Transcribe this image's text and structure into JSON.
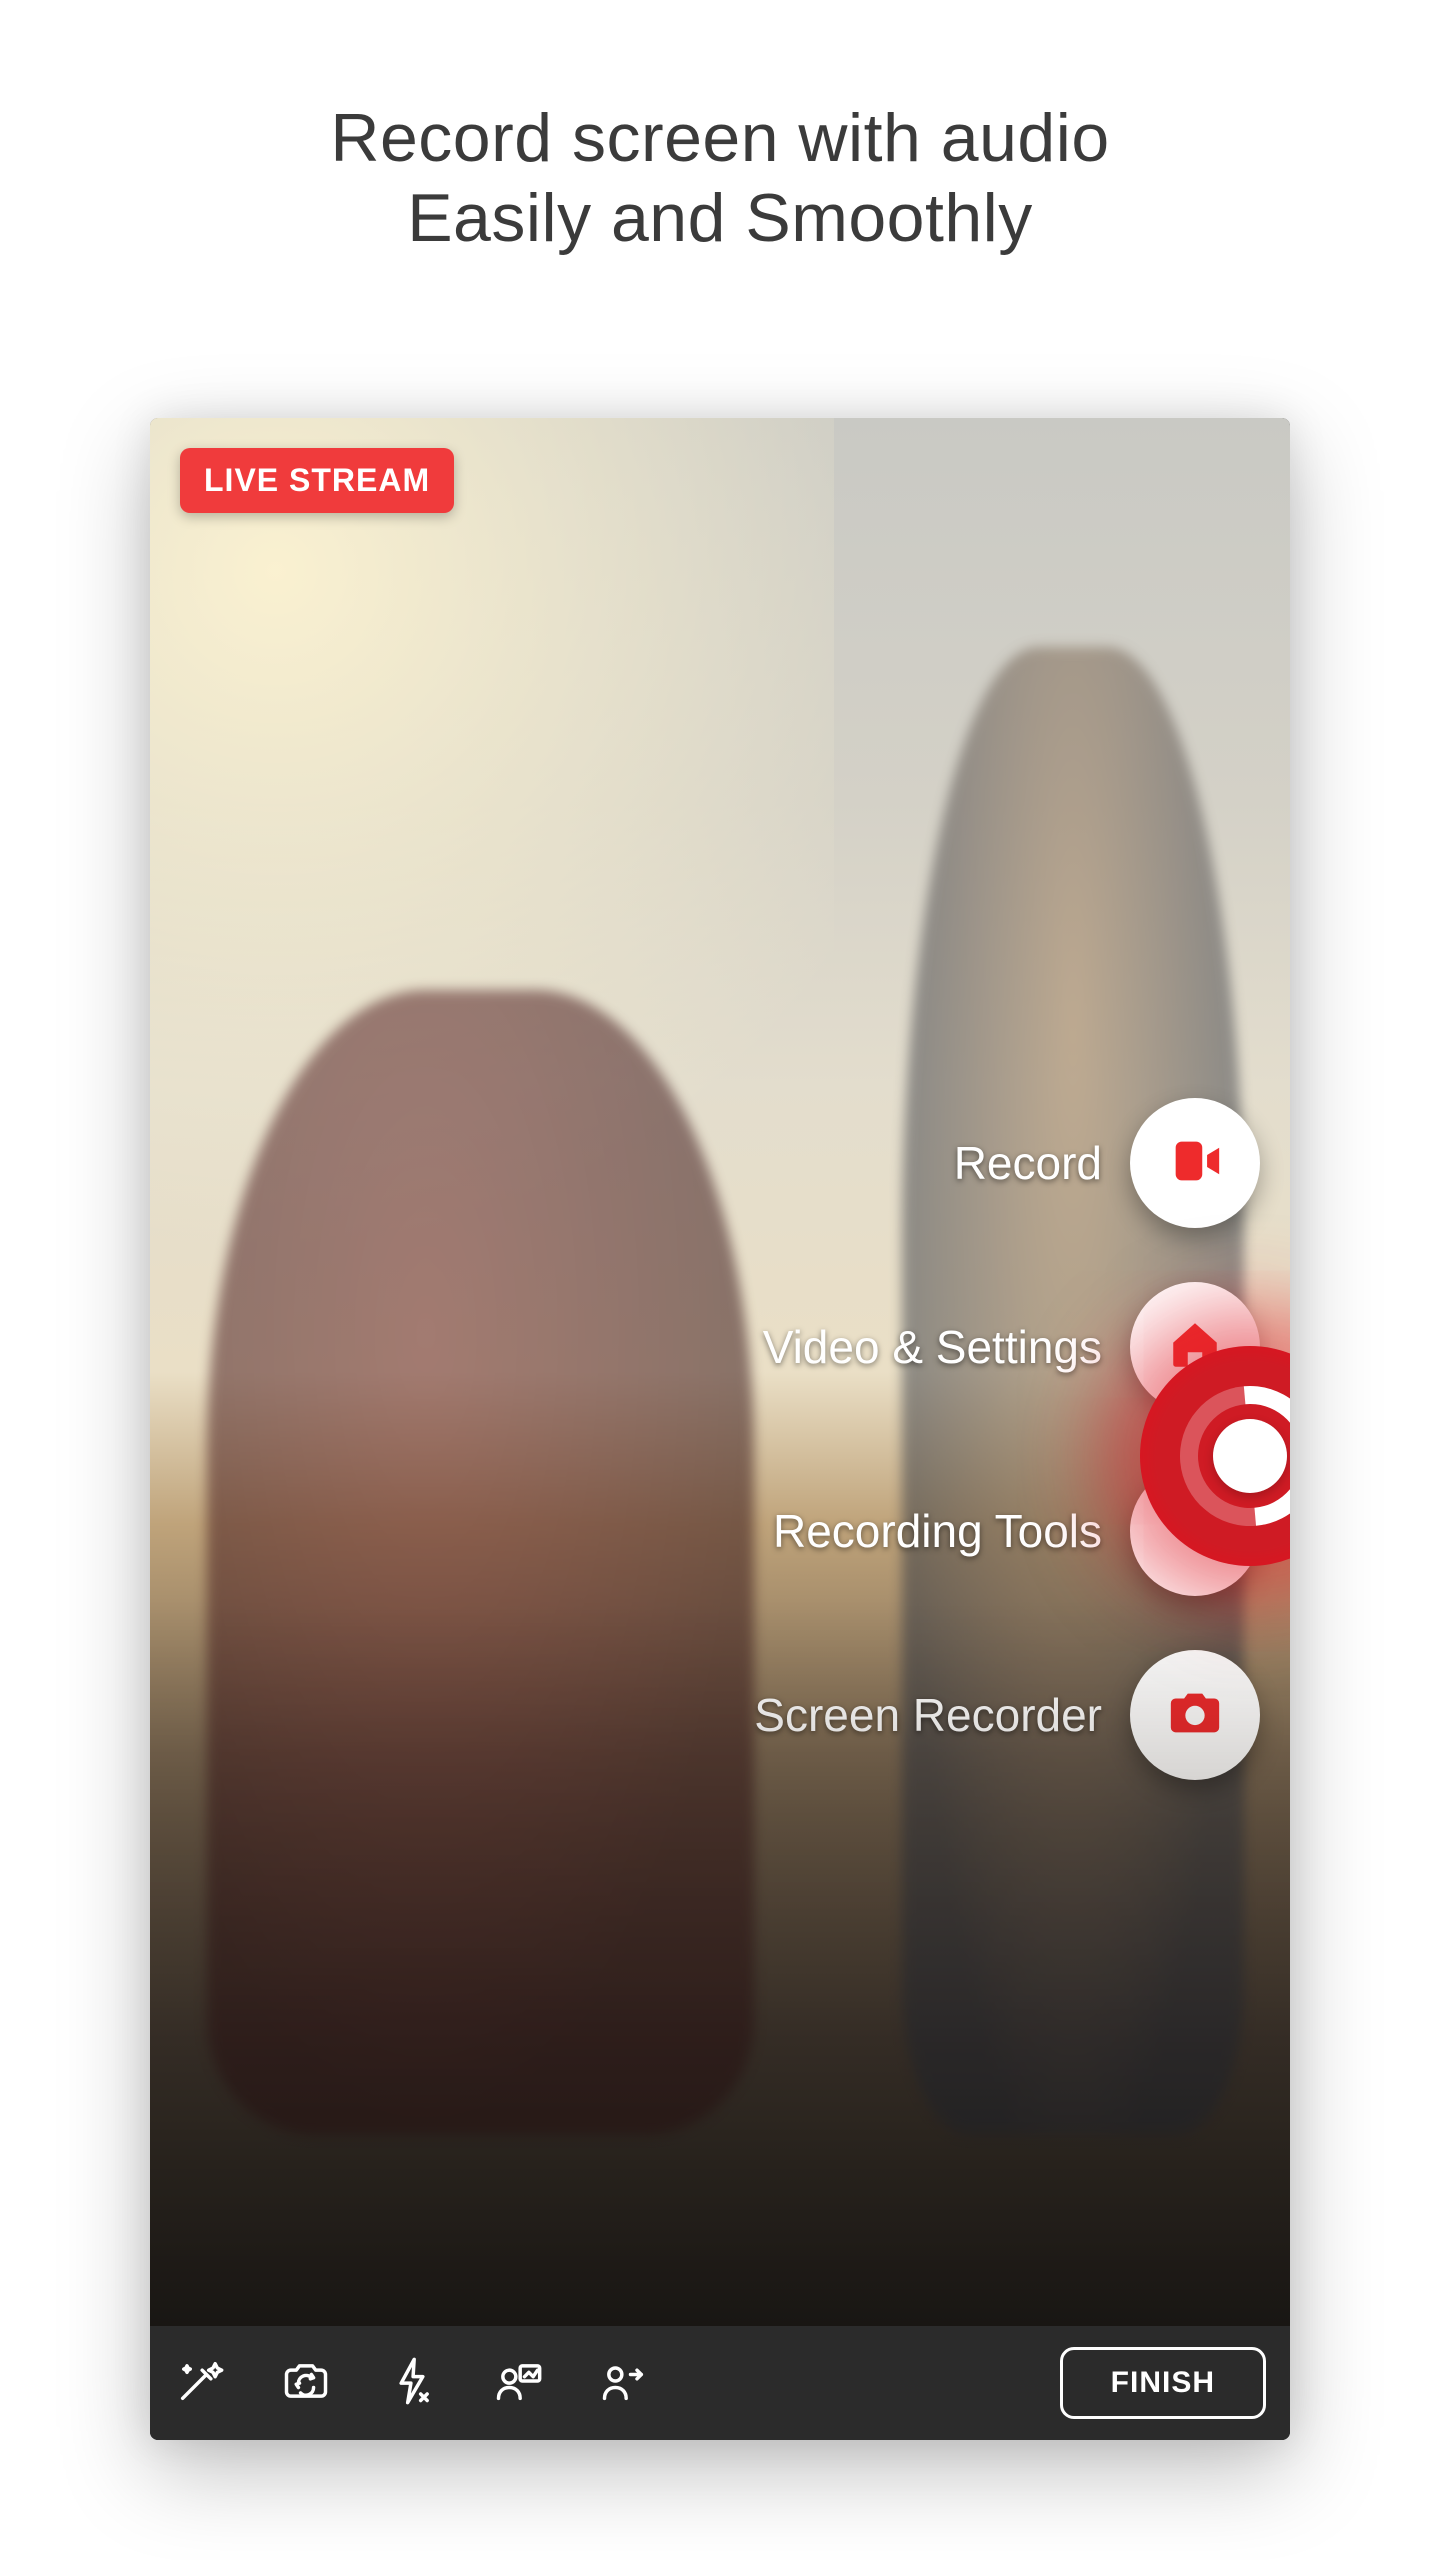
{
  "headline": {
    "line1": "Record screen with audio",
    "line2": "Easily and Smoothly"
  },
  "live_badge": "LIVE STREAM",
  "float_menu": {
    "items": [
      {
        "label": "Record",
        "icon": "video-camera-icon"
      },
      {
        "label": "Video & Settings",
        "icon": "home-icon"
      },
      {
        "label": "Recording Tools",
        "icon": "eye-icon"
      },
      {
        "label": "Screen Recorder",
        "icon": "camera-icon"
      }
    ]
  },
  "record_bubble": {
    "icon": "record-status-icon"
  },
  "toolbar": {
    "icons": [
      "magic-wand-icon",
      "camera-switch-icon",
      "flash-off-icon",
      "person-frame-icon",
      "person-share-icon"
    ],
    "finish_label": "FINISH"
  },
  "colors": {
    "accent_red": "#ee2b2c",
    "badge_red": "#f03b3c",
    "bubble_red": "#cf1b24",
    "toolbar_bg": "#2b2b2b",
    "headline_text": "#3b3b3b"
  }
}
